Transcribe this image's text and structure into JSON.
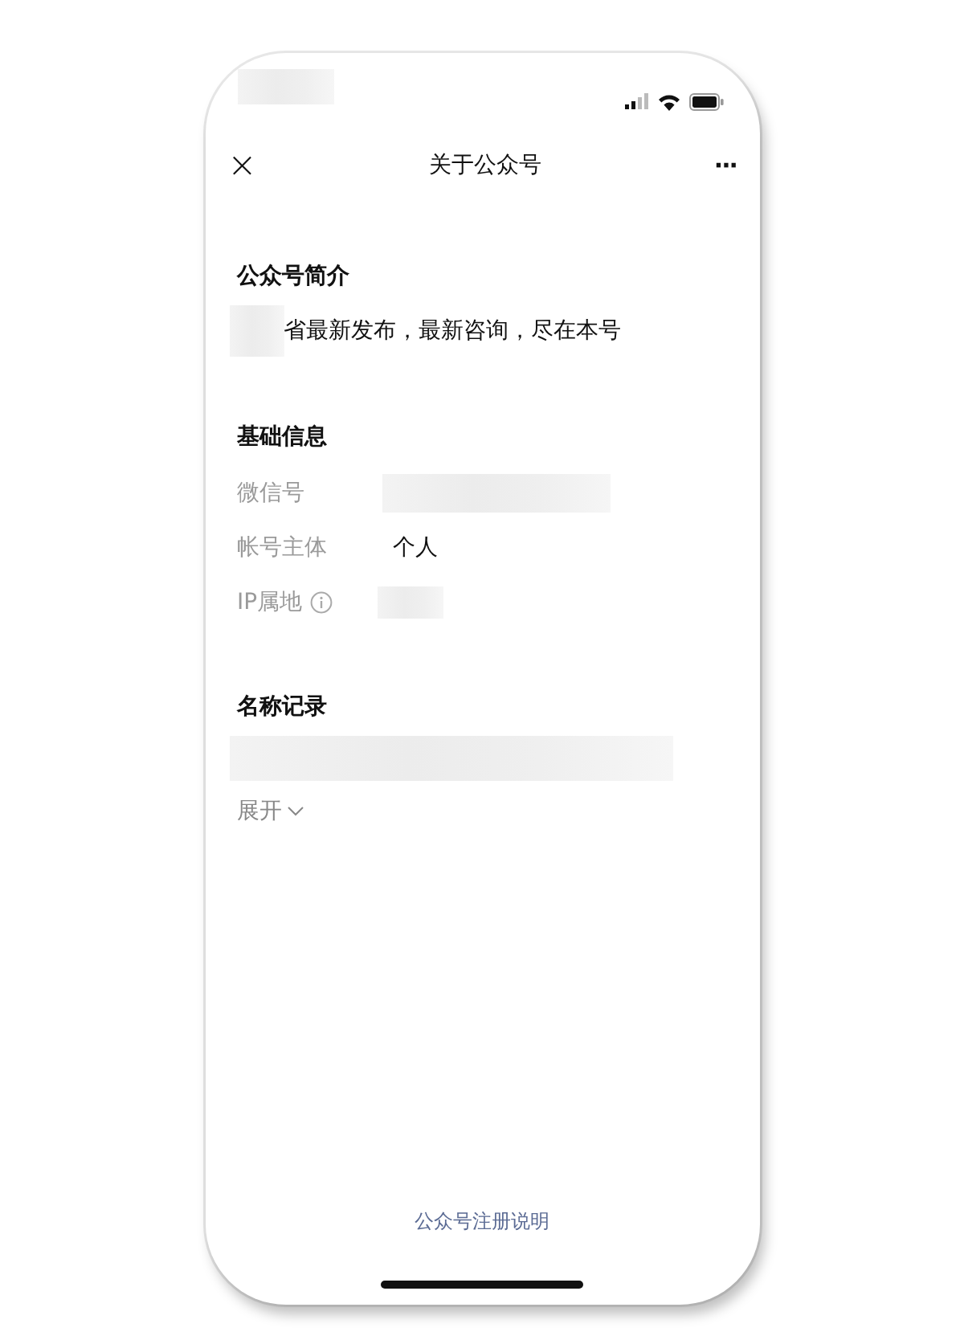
{
  "nav": {
    "title": "关于公众号",
    "close": "×",
    "more": "···"
  },
  "intro": {
    "heading": "公众号简介",
    "text": "省最新发布，最新咨询，尽在本号"
  },
  "basic_info": {
    "heading": "基础信息",
    "rows": [
      {
        "label": "微信号",
        "kind": "redacted",
        "info": false
      },
      {
        "label": "帐号主体",
        "kind": "text",
        "value": "个人",
        "info": false
      },
      {
        "label": "IP属地",
        "kind": "redacted",
        "info": true
      }
    ]
  },
  "name_records": {
    "heading": "名称记录",
    "expand": "展开"
  },
  "footer_link": "公众号注册说明"
}
